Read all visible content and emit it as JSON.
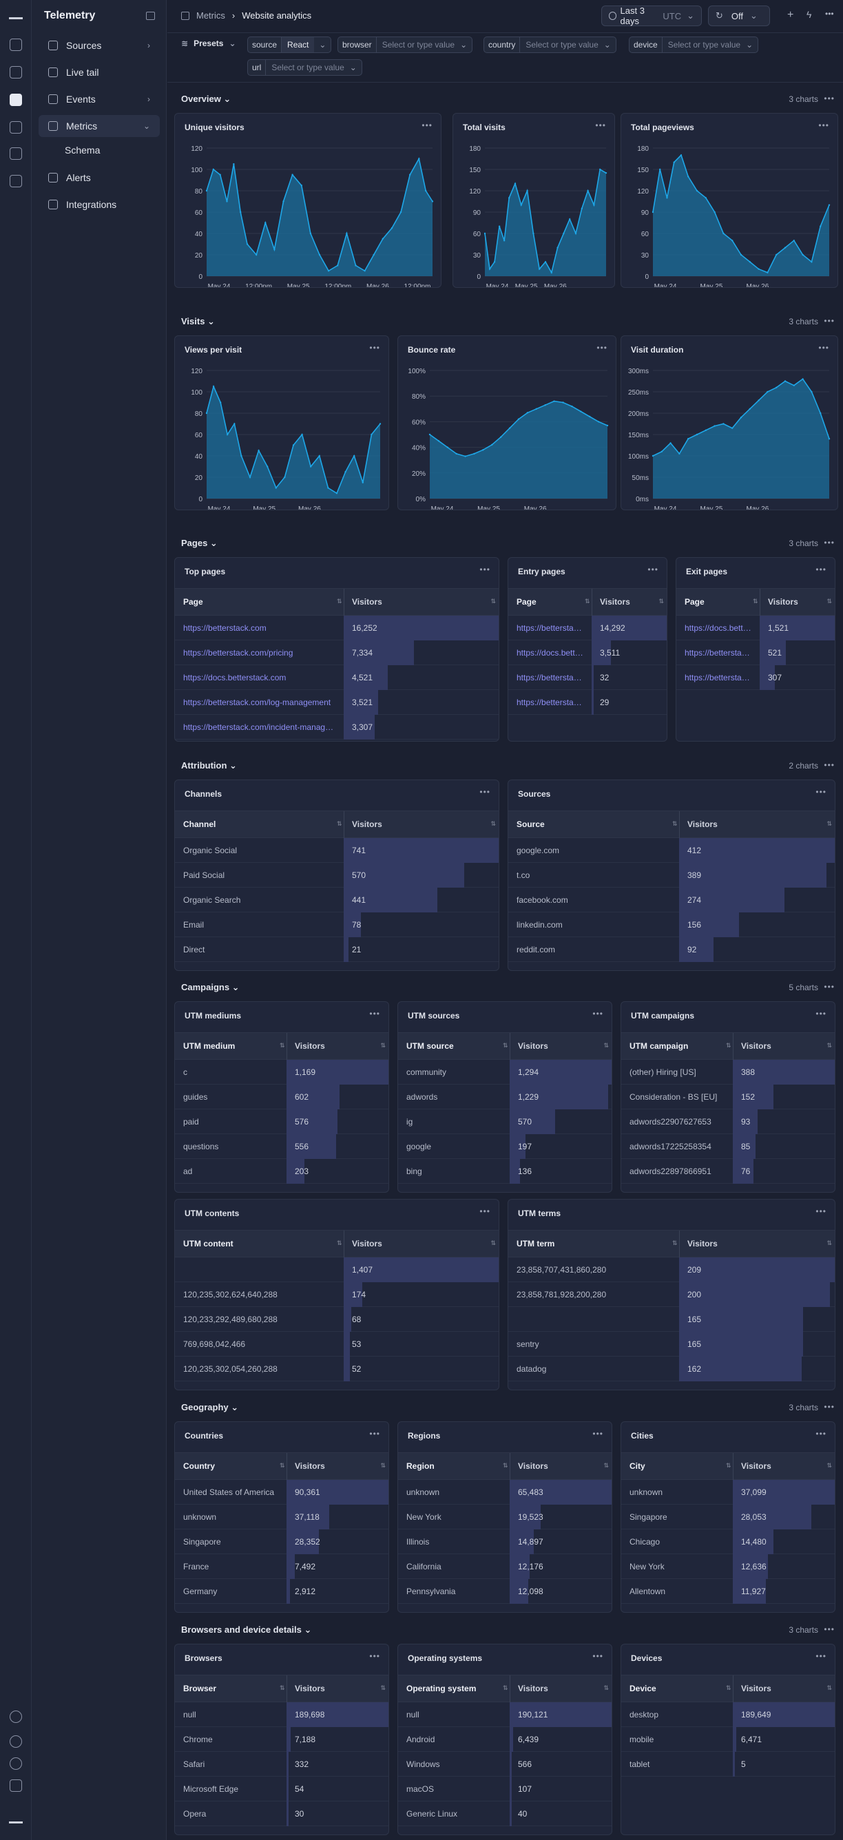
{
  "app": {
    "name": "Telemetry"
  },
  "nav": {
    "items": [
      {
        "label": "Sources"
      },
      {
        "label": "Live tail"
      },
      {
        "label": "Events"
      },
      {
        "label": "Metrics"
      },
      {
        "label": "Alerts"
      },
      {
        "label": "Integrations"
      }
    ],
    "sub": "Schema"
  },
  "breadcrumb": {
    "root": "Metrics",
    "current": "Website analytics"
  },
  "toolbar": {
    "range": "Last 3 days",
    "tz": "UTC",
    "refresh": "Off"
  },
  "filters": {
    "presets": "Presets",
    "source_key": "source",
    "source_val": "React",
    "browser_key": "browser",
    "country_key": "country",
    "device_key": "device",
    "url_key": "url",
    "placeholder": "Select or type value"
  },
  "sections": [
    {
      "title": "Overview",
      "count": "3 charts"
    },
    {
      "title": "Visits",
      "count": "3 charts"
    },
    {
      "title": "Pages",
      "count": "3 charts"
    },
    {
      "title": "Attribution",
      "count": "2 charts"
    },
    {
      "title": "Campaigns",
      "count": "5 charts"
    },
    {
      "title": "Geography",
      "count": "3 charts"
    },
    {
      "title": "Browsers and device details",
      "count": "3 charts"
    }
  ],
  "chart_data": [
    {
      "type": "area",
      "title": "Unique visitors",
      "yticks": [
        "0",
        "20",
        "40",
        "60",
        "80",
        "100",
        "120"
      ],
      "ylim": [
        0,
        120
      ],
      "xticks": [
        "May 24",
        "12:00pm",
        "May 25",
        "12:00pm",
        "May 26",
        "12:00pm"
      ],
      "x": [
        0,
        0.03,
        0.06,
        0.09,
        0.12,
        0.15,
        0.18,
        0.22,
        0.26,
        0.3,
        0.34,
        0.38,
        0.42,
        0.46,
        0.5,
        0.54,
        0.58,
        0.62,
        0.66,
        0.7,
        0.74,
        0.78,
        0.82,
        0.86,
        0.9,
        0.94,
        0.97,
        1
      ],
      "y": [
        80,
        100,
        95,
        70,
        105,
        60,
        30,
        20,
        50,
        25,
        70,
        95,
        85,
        40,
        20,
        5,
        10,
        40,
        10,
        5,
        20,
        35,
        45,
        60,
        95,
        110,
        80,
        70
      ]
    },
    {
      "type": "area",
      "title": "Total visits",
      "yticks": [
        "0",
        "30",
        "60",
        "90",
        "120",
        "150",
        "180"
      ],
      "ylim": [
        0,
        180
      ],
      "xticks": [
        "May 24",
        "May 25",
        "May 26"
      ],
      "x": [
        0,
        0.04,
        0.08,
        0.12,
        0.16,
        0.2,
        0.25,
        0.3,
        0.35,
        0.4,
        0.45,
        0.5,
        0.55,
        0.6,
        0.65,
        0.7,
        0.75,
        0.8,
        0.85,
        0.9,
        0.95,
        1
      ],
      "y": [
        60,
        10,
        20,
        70,
        50,
        110,
        130,
        100,
        120,
        60,
        10,
        20,
        5,
        40,
        60,
        80,
        60,
        95,
        120,
        100,
        150,
        145
      ]
    },
    {
      "type": "area",
      "title": "Total pageviews",
      "yticks": [
        "0",
        "30",
        "60",
        "90",
        "120",
        "150",
        "180"
      ],
      "ylim": [
        0,
        180
      ],
      "xticks": [
        "May 24",
        "May 25",
        "May 26"
      ],
      "x": [
        0,
        0.04,
        0.08,
        0.12,
        0.16,
        0.2,
        0.25,
        0.3,
        0.35,
        0.4,
        0.45,
        0.5,
        0.55,
        0.6,
        0.65,
        0.7,
        0.75,
        0.8,
        0.85,
        0.9,
        0.95,
        1
      ],
      "y": [
        90,
        150,
        110,
        160,
        170,
        140,
        120,
        110,
        90,
        60,
        50,
        30,
        20,
        10,
        5,
        30,
        40,
        50,
        30,
        20,
        70,
        100
      ]
    },
    {
      "type": "area",
      "title": "Views per visit",
      "yticks": [
        "0",
        "20",
        "40",
        "60",
        "80",
        "100",
        "120"
      ],
      "ylim": [
        0,
        120
      ],
      "xticks": [
        "May 24",
        "May 25",
        "May 26"
      ],
      "x": [
        0,
        0.04,
        0.08,
        0.12,
        0.16,
        0.2,
        0.25,
        0.3,
        0.35,
        0.4,
        0.45,
        0.5,
        0.55,
        0.6,
        0.65,
        0.7,
        0.75,
        0.8,
        0.85,
        0.9,
        0.95,
        1
      ],
      "y": [
        80,
        105,
        90,
        60,
        70,
        40,
        20,
        45,
        30,
        10,
        20,
        50,
        60,
        30,
        40,
        10,
        5,
        25,
        40,
        15,
        60,
        70
      ]
    },
    {
      "type": "area",
      "title": "Bounce rate",
      "yticks": [
        "0%",
        "20%",
        "40%",
        "60%",
        "80%",
        "100%"
      ],
      "ylim": [
        0,
        100
      ],
      "xticks": [
        "May 24",
        "May 25",
        "May 26"
      ],
      "x": [
        0,
        0.05,
        0.1,
        0.15,
        0.2,
        0.25,
        0.3,
        0.35,
        0.4,
        0.45,
        0.5,
        0.55,
        0.6,
        0.65,
        0.7,
        0.75,
        0.8,
        0.85,
        0.9,
        0.95,
        1
      ],
      "y": [
        50,
        45,
        40,
        35,
        33,
        35,
        38,
        42,
        48,
        55,
        62,
        67,
        70,
        73,
        76,
        75,
        72,
        68,
        64,
        60,
        57
      ]
    },
    {
      "type": "area",
      "title": "Visit duration",
      "yticks": [
        "0ms",
        "50ms",
        "100ms",
        "150ms",
        "200ms",
        "250ms",
        "300ms"
      ],
      "ylim": [
        0,
        300
      ],
      "xticks": [
        "May 24",
        "May 25",
        "May 26"
      ],
      "x": [
        0,
        0.05,
        0.1,
        0.15,
        0.2,
        0.25,
        0.3,
        0.35,
        0.4,
        0.45,
        0.5,
        0.55,
        0.6,
        0.65,
        0.7,
        0.75,
        0.8,
        0.85,
        0.9,
        0.95,
        1
      ],
      "y": [
        100,
        110,
        130,
        105,
        140,
        150,
        160,
        170,
        175,
        165,
        190,
        210,
        230,
        250,
        260,
        275,
        265,
        280,
        250,
        200,
        140
      ]
    }
  ],
  "tables": [
    {
      "title": "Top pages",
      "col1": "Page",
      "col2": "Visitors",
      "rows": [
        [
          "https://betterstack.com",
          "16,252",
          1.0
        ],
        [
          "https://betterstack.com/pricing",
          "7,334",
          0.45
        ],
        [
          "https://docs.betterstack.com",
          "4,521",
          0.28
        ],
        [
          "https://betterstack.com/log-management",
          "3,521",
          0.22
        ],
        [
          "https://betterstack.com/incident-manag…",
          "3,307",
          0.2
        ]
      ],
      "link": true
    },
    {
      "title": "Entry pages",
      "col1": "Page",
      "col2": "Visitors",
      "rows": [
        [
          "https://bettersta…",
          "14,292",
          1.0
        ],
        [
          "https://docs.bett…",
          "3,511",
          0.25
        ],
        [
          "https://bettersta…",
          "32",
          0.02
        ],
        [
          "https://bettersta…",
          "29",
          0.02
        ]
      ],
      "link": true
    },
    {
      "title": "Exit pages",
      "col1": "Page",
      "col2": "Visitors",
      "rows": [
        [
          "https://docs.bett…",
          "1,521",
          1.0
        ],
        [
          "https://bettersta…",
          "521",
          0.34
        ],
        [
          "https://bettersta…",
          "307",
          0.2
        ]
      ],
      "link": true
    },
    {
      "title": "Channels",
      "col1": "Channel",
      "col2": "Visitors",
      "rows": [
        [
          "Organic Social",
          "741",
          1.0
        ],
        [
          "Paid Social",
          "570",
          0.77
        ],
        [
          "Organic Search",
          "441",
          0.6
        ],
        [
          "Email",
          "78",
          0.11
        ],
        [
          "Direct",
          "21",
          0.03
        ]
      ]
    },
    {
      "title": "Sources",
      "col1": "Source",
      "col2": "Visitors",
      "rows": [
        [
          "google.com",
          "412",
          1.0
        ],
        [
          "t.co",
          "389",
          0.94
        ],
        [
          "facebook.com",
          "274",
          0.67
        ],
        [
          "linkedin.com",
          "156",
          0.38
        ],
        [
          "reddit.com",
          "92",
          0.22
        ]
      ]
    },
    {
      "title": "UTM mediums",
      "col1": "UTM medium",
      "col2": "Visitors",
      "rows": [
        [
          "c",
          "1,169",
          1.0
        ],
        [
          "guides",
          "602",
          0.51
        ],
        [
          "paid",
          "576",
          0.49
        ],
        [
          "questions",
          "556",
          0.48
        ],
        [
          "ad",
          "203",
          0.17
        ]
      ]
    },
    {
      "title": "UTM sources",
      "col1": "UTM source",
      "col2": "Visitors",
      "rows": [
        [
          "community",
          "1,294",
          1.0
        ],
        [
          "adwords",
          "1,229",
          0.95
        ],
        [
          "ig",
          "570",
          0.44
        ],
        [
          "google",
          "197",
          0.15
        ],
        [
          "bing",
          "136",
          0.1
        ]
      ]
    },
    {
      "title": "UTM campaigns",
      "col1": "UTM campaign",
      "col2": "Visitors",
      "rows": [
        [
          "(other) Hiring [US]",
          "388",
          1.0
        ],
        [
          "Consideration - BS [EU]",
          "152",
          0.39
        ],
        [
          "adwords22907627653",
          "93",
          0.24
        ],
        [
          "adwords17225258354",
          "85",
          0.22
        ],
        [
          "adwords22897866951",
          "76",
          0.2
        ]
      ]
    },
    {
      "title": "UTM contents",
      "col1": "UTM content",
      "col2": "Visitors",
      "rows": [
        [
          "",
          "1,407",
          1.0
        ],
        [
          "120,235,302,624,640,288",
          "174",
          0.12
        ],
        [
          "120,233,292,489,680,288",
          "68",
          0.05
        ],
        [
          "769,698,042,466",
          "53",
          0.04
        ],
        [
          "120,235,302,054,260,288",
          "52",
          0.04
        ]
      ]
    },
    {
      "title": "UTM terms",
      "col1": "UTM term",
      "col2": "Visitors",
      "rows": [
        [
          "23,858,707,431,860,280",
          "209",
          1.0
        ],
        [
          "23,858,781,928,200,280",
          "200",
          0.96
        ],
        [
          "",
          "165",
          0.79
        ],
        [
          "sentry",
          "165",
          0.79
        ],
        [
          "datadog",
          "162",
          0.78
        ]
      ]
    },
    {
      "title": "Countries",
      "col1": "Country",
      "col2": "Visitors",
      "rows": [
        [
          "United States of America",
          "90,361",
          1.0
        ],
        [
          "unknown",
          "37,118",
          0.41
        ],
        [
          "Singapore",
          "28,352",
          0.31
        ],
        [
          "France",
          "7,492",
          0.08
        ],
        [
          "Germany",
          "2,912",
          0.03
        ]
      ]
    },
    {
      "title": "Regions",
      "col1": "Region",
      "col2": "Visitors",
      "rows": [
        [
          "unknown",
          "65,483",
          1.0
        ],
        [
          "New York",
          "19,523",
          0.3
        ],
        [
          "Illinois",
          "14,897",
          0.23
        ],
        [
          "California",
          "12,176",
          0.19
        ],
        [
          "Pennsylvania",
          "12,098",
          0.18
        ]
      ]
    },
    {
      "title": "Cities",
      "col1": "City",
      "col2": "Visitors",
      "rows": [
        [
          "unknown",
          "37,099",
          1.0
        ],
        [
          "Singapore",
          "28,053",
          0.76
        ],
        [
          "Chicago",
          "14,480",
          0.39
        ],
        [
          "New York",
          "12,636",
          0.34
        ],
        [
          "Allentown",
          "11,927",
          0.32
        ]
      ]
    },
    {
      "title": "Browsers",
      "col1": "Browser",
      "col2": "Visitors",
      "rows": [
        [
          "null",
          "189,698",
          1.0
        ],
        [
          "Chrome",
          "7,188",
          0.04
        ],
        [
          "Safari",
          "332",
          0.01
        ],
        [
          "Microsoft Edge",
          "54",
          0.0
        ],
        [
          "Opera",
          "30",
          0.0
        ]
      ]
    },
    {
      "title": "Operating systems",
      "col1": "Operating system",
      "col2": "Visitors",
      "rows": [
        [
          "null",
          "190,121",
          1.0
        ],
        [
          "Android",
          "6,439",
          0.03
        ],
        [
          "Windows",
          "566",
          0.01
        ],
        [
          "macOS",
          "107",
          0.0
        ],
        [
          "Generic Linux",
          "40",
          0.0
        ]
      ]
    },
    {
      "title": "Devices",
      "col1": "Device",
      "col2": "Visitors",
      "rows": [
        [
          "desktop",
          "189,649",
          1.0
        ],
        [
          "mobile",
          "6,471",
          0.03
        ],
        [
          "tablet",
          "5",
          0.0
        ]
      ]
    }
  ]
}
